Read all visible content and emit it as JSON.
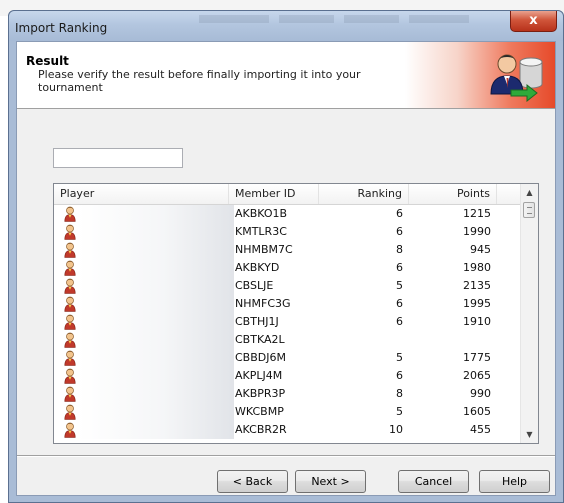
{
  "window": {
    "title": "Import Ranking",
    "close_label": "x"
  },
  "banner": {
    "title": "Result",
    "description": "Please verify the result before finally importing it into your tournament"
  },
  "filter": {
    "value": "",
    "placeholder": ""
  },
  "table": {
    "columns": [
      "Player",
      "Member ID",
      "Ranking",
      "Points"
    ],
    "rows": [
      {
        "member_id": "AKBKO1B",
        "ranking": "6",
        "points": "1215"
      },
      {
        "member_id": "KMTLR3C",
        "ranking": "6",
        "points": "1990"
      },
      {
        "member_id": "NHMBM7C",
        "ranking": "8",
        "points": "945"
      },
      {
        "member_id": "AKBKYD",
        "ranking": "6",
        "points": "1980"
      },
      {
        "member_id": "CBSLJE",
        "ranking": "5",
        "points": "2135"
      },
      {
        "member_id": "NHMFC3G",
        "ranking": "6",
        "points": "1995"
      },
      {
        "member_id": "CBTHJ1J",
        "ranking": "6",
        "points": "1910"
      },
      {
        "member_id": "CBTKA2L",
        "ranking": "",
        "points": ""
      },
      {
        "member_id": "CBBDJ6M",
        "ranking": "5",
        "points": "1775"
      },
      {
        "member_id": "AKPLJ4M",
        "ranking": "6",
        "points": "2065"
      },
      {
        "member_id": "AKBPR3P",
        "ranking": "8",
        "points": "990"
      },
      {
        "member_id": "WKCBMP",
        "ranking": "5",
        "points": "1605"
      },
      {
        "member_id": "AKCBR2R",
        "ranking": "10",
        "points": "455"
      }
    ]
  },
  "buttons": {
    "back": "< Back",
    "next": "Next >",
    "cancel": "Cancel",
    "help": "Help"
  },
  "colors": {
    "banner_accent": "#e64a2a",
    "title_bar": "#b3c6df",
    "close": "#c0392b"
  }
}
